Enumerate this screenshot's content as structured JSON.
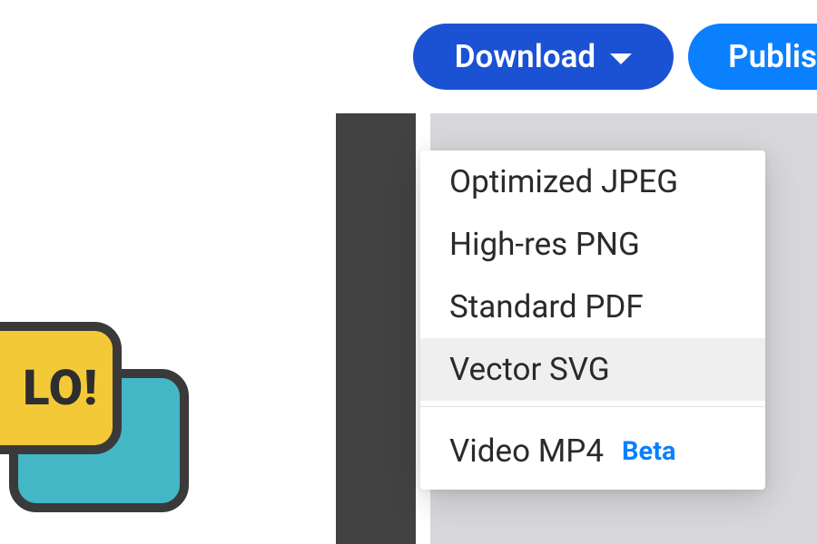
{
  "toolbar": {
    "download_label": "Download",
    "publish_label": "Publis"
  },
  "speech": {
    "front_text": "LO!"
  },
  "dropdown": {
    "items": [
      {
        "label": "Optimized JPEG",
        "highlighted": false
      },
      {
        "label": "High-res PNG",
        "highlighted": false
      },
      {
        "label": "Standard PDF",
        "highlighted": false
      },
      {
        "label": "Vector SVG",
        "highlighted": true
      }
    ],
    "video_label": "Video MP4",
    "video_badge": "Beta"
  }
}
